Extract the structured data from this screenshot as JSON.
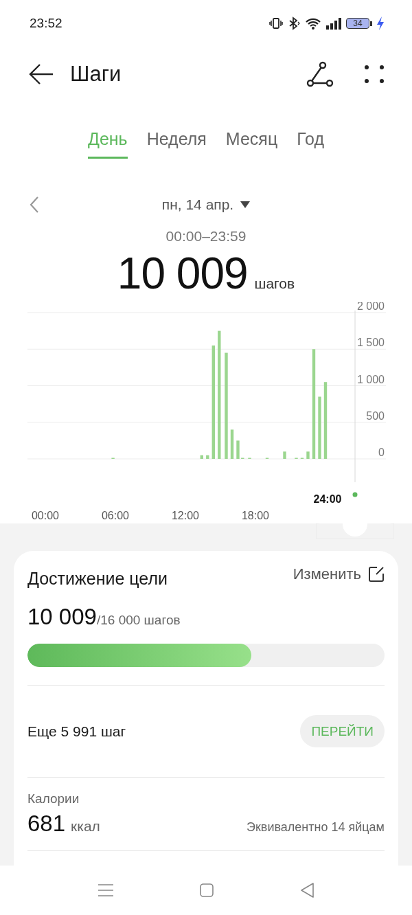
{
  "status_bar": {
    "time": "23:52",
    "battery": "34"
  },
  "header": {
    "title": "Шаги"
  },
  "tabs": [
    {
      "label": "День",
      "selected": true
    },
    {
      "label": "Неделя",
      "selected": false
    },
    {
      "label": "Месяц",
      "selected": false
    },
    {
      "label": "Год",
      "selected": false
    }
  ],
  "date_nav": {
    "date": "пн, 14 апр.",
    "range": "00:00–23:59"
  },
  "total": {
    "value": "10 009",
    "unit": "шагов"
  },
  "chart": {
    "cursor_label": "24:00",
    "chart_data": {
      "type": "bar",
      "x": [
        5.8,
        13.4,
        13.9,
        14.4,
        14.9,
        15.5,
        16.0,
        16.5,
        16.9,
        17.5,
        19.0,
        20.5,
        21.5,
        22.0,
        22.5,
        23.0,
        23.5,
        24.0
      ],
      "values": [
        10,
        50,
        50,
        1550,
        1750,
        1450,
        400,
        250,
        10,
        10,
        10,
        100,
        10,
        10,
        100,
        1500,
        850,
        1050
      ],
      "grid": true,
      "xlim": [
        0,
        24
      ],
      "ylim": [
        0,
        2000
      ],
      "xticks": [
        {
          "value": 0,
          "label": "00:00"
        },
        {
          "value": 6,
          "label": "06:00"
        },
        {
          "value": 12,
          "label": "12:00"
        },
        {
          "value": 18,
          "label": "18:00"
        }
      ],
      "yticks": [
        {
          "value": 0,
          "label": "0"
        },
        {
          "value": 500,
          "label": "500"
        },
        {
          "value": 1000,
          "label": "1 000"
        },
        {
          "value": 1500,
          "label": "1 500"
        },
        {
          "value": 2000,
          "label": "2 000"
        }
      ]
    }
  },
  "goal_card": {
    "title": "Достижение цели",
    "edit_label": "Изменить",
    "current": "10 009",
    "target": "/16 000 шагов",
    "level": 0.626,
    "remaining": "Еще 5 991 шаг",
    "go_button": "ПЕРЕЙТИ",
    "calories_label": "Калории",
    "calories_value": "681",
    "calories_unit": "ккал",
    "equivalent": "Эквивалентно 14 яйцам"
  }
}
